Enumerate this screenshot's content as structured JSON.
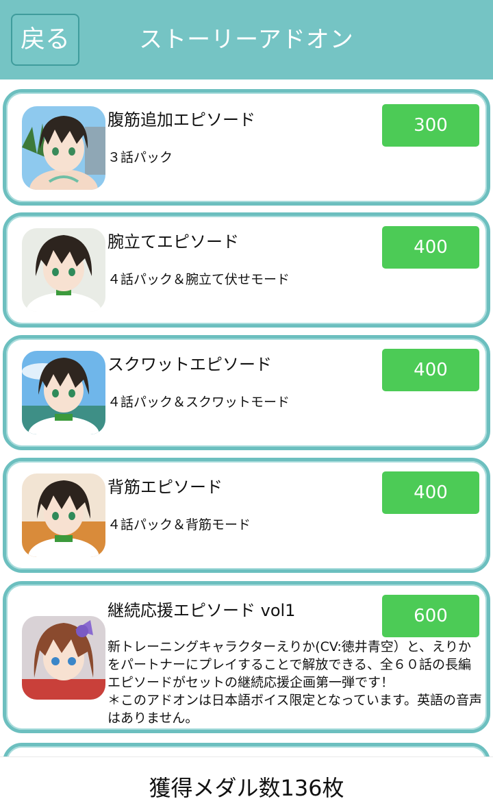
{
  "header": {
    "back_label": "戻る",
    "title": "ストーリーアドオン"
  },
  "items": [
    {
      "title": "腹筋追加エピソード",
      "description": "３話パック",
      "price": "300"
    },
    {
      "title": "腕立てエピソード",
      "description": "４話パック＆腕立て伏せモード",
      "price": "400"
    },
    {
      "title": "スクワットエピソード",
      "description": "４話パック＆スクワットモード",
      "price": "400"
    },
    {
      "title": "背筋エピソード",
      "description": "４話パック＆背筋モード",
      "price": "400"
    },
    {
      "title": "継続応援エピソード vol1",
      "description": "新トレーニングキャラクターえりか(CV:徳井青空）と、えりかをパートナーにプレイすることで解放できる、全６０話の長編エピソードがセットの継続応援企画第一弾です！\n＊このアドオンは日本語ボイス限定となっています。英語の音声はありません。",
      "price": "600"
    }
  ],
  "footer": {
    "medal_count_text": "獲得メダル数136枚"
  },
  "colors": {
    "header_bg": "#75c4c4",
    "card_border": "#6cbfbf",
    "price_button": "#4ccb56"
  }
}
